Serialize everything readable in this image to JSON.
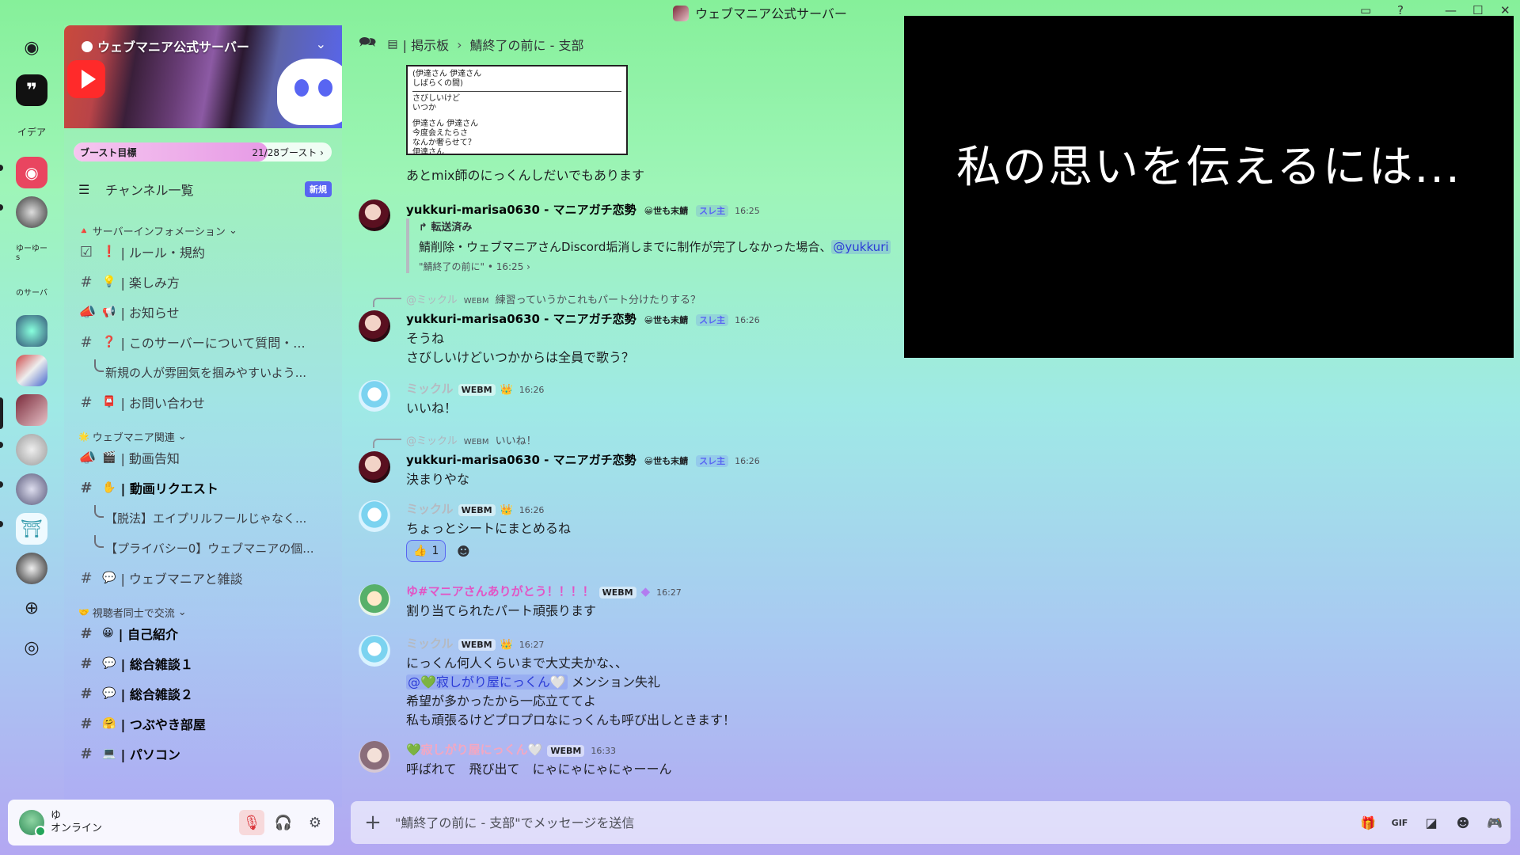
{
  "window": {
    "title": "ウェブマニア公式サーバー"
  },
  "rail": {
    "text_servers": [
      "イデア",
      "ゆーゆーs",
      "のサーバ"
    ]
  },
  "server": {
    "name": "ウェブマニア公式サーバー",
    "boost_label": "ブースト目標",
    "boost_count": "21/28ブースト ›",
    "boost_fraction": 0.75,
    "channel_list_label": "チャンネル一覧",
    "new_badge": "新規"
  },
  "categories": [
    {
      "name": "サーバーインフォメーション",
      "chevron": "⌄"
    },
    {
      "name": "ウェブマニア関連",
      "chevron": "⌄"
    },
    {
      "name": "視聴者同士で交流",
      "chevron": "⌄"
    }
  ],
  "channels": [
    {
      "emoji": "❗",
      "name": "| ルール・規約"
    },
    {
      "emoji": "💡",
      "name": "| 楽しみ方"
    },
    {
      "emoji": "📢",
      "name": "| お知らせ"
    },
    {
      "emoji": "❓",
      "name": "| このサーバーについて質問・..."
    },
    {
      "name": "新規の人が雰囲気を掴みやすいよう..."
    },
    {
      "emoji": "📮",
      "name": "| お問い合わせ"
    },
    {
      "emoji": "🎬",
      "name": "| 動画告知"
    },
    {
      "emoji": "✋",
      "name": "| 動画リクエスト"
    },
    {
      "name": "【脱法】エイプリルフールじゃなく..."
    },
    {
      "name": "【プライバシー0】ウェブマニアの個..."
    },
    {
      "emoji": "💬",
      "name": "| ウェブマニアと雑談"
    },
    {
      "emoji": "😀",
      "name": "| 自己紹介"
    },
    {
      "emoji": "💬",
      "name": "| 総合雑談１"
    },
    {
      "emoji": "💬",
      "name": "| 総合雑談２"
    },
    {
      "emoji": "🤗",
      "name": "| つぶやき部屋"
    },
    {
      "emoji": "💻",
      "name": "| パソコン"
    }
  ],
  "user": {
    "name": "ゆ",
    "status": "オンライン"
  },
  "header": {
    "forum": "| 掲示板",
    "sep": "›",
    "thread": "鯖終了の前に - 支部"
  },
  "embed_text": [
    "(伊達さん 伊達さん",
    "しばらくの間)",
    "さびしいけど",
    "いつか",
    "伊達さん 伊達さん",
    "今度会えたらさ",
    "なんか奢らせて？",
    "伊達さん"
  ],
  "messages": {
    "m0": {
      "text": "あとmix師のにっくんしだいでもあります"
    },
    "m1": {
      "name": "yukkuri-marisa0630 - マニアガチ恋勢",
      "tag1": "😀世も末鯖",
      "tag2": "スレ主",
      "time": "16:25",
      "fwd_label": "↱ 転送済み",
      "fwd_text": "鯖削除・ウェブマニアさんDiscord垢消しまでに制作が完了しなかった場合、",
      "fwd_mention": "@yukkuri",
      "fwd_meta": "\"鯖終了の前に\" • 16:25 ›"
    },
    "m2": {
      "reply_name": "@ミックル",
      "reply_tag": "WEBM",
      "reply_text": "練習っていうかこれもパート分けたりする？",
      "name": "yukkuri-marisa0630 - マニアガチ恋勢",
      "tag1": "😀世も末鯖",
      "tag2": "スレ主",
      "time": "16:26",
      "line1": "そうね",
      "line2": "さびしいけどいつかからは全員で歌う？"
    },
    "m3": {
      "name": "ミックル",
      "tag": "WEBM",
      "crown": "👑",
      "time": "16:26",
      "line1": "いいね！"
    },
    "m4": {
      "reply_name": "@ミックル",
      "reply_tag": "WEBM",
      "reply_text": "いいね！",
      "name": "yukkuri-marisa0630 - マニアガチ恋勢",
      "tag1": "😀世も末鯖",
      "tag2": "スレ主",
      "time": "16:26",
      "line1": "決まりやな"
    },
    "m5": {
      "name": "ミックル",
      "tag": "WEBM",
      "crown": "👑",
      "time": "16:26",
      "line1": "ちょっとシートにまとめるね",
      "reaction_emoji": "👍",
      "reaction_count": "1"
    },
    "m6": {
      "name": "ゆ#マニアさんありがとう！！！！",
      "tag": "WEBM",
      "time": "16:27",
      "line1": "割り当てられたパート頑張ります"
    },
    "m7": {
      "name": "ミックル",
      "tag": "WEBM",
      "crown": "👑",
      "time": "16:27",
      "line1": "にっくん何人くらいまで大丈夫かな、、",
      "mention": "@💚寂しがり屋にっくん🤍",
      "line2_rest": " メンション失礼",
      "line3": "希望が多かったから一応立ててよ",
      "line4": "私も頑張るけどプロプロなにっくんも呼び出しときます！"
    },
    "m8": {
      "name": "💚寂しがり屋にっくん🤍",
      "tag": "WEBM",
      "time": "16:33",
      "line1": "呼ばれて　飛び出て　にゃにゃにゃにゃーーん"
    }
  },
  "composer": {
    "placeholder": "\"鯖終了の前に - 支部\"でメッセージを送信"
  },
  "overlay": {
    "text": "私の思いを伝えるには..."
  },
  "colors": {
    "accent": "#5865f2",
    "miku_name": "#b5bac1",
    "yu_name": "#e255c5",
    "nikkun_name": "#f4a7c1"
  }
}
